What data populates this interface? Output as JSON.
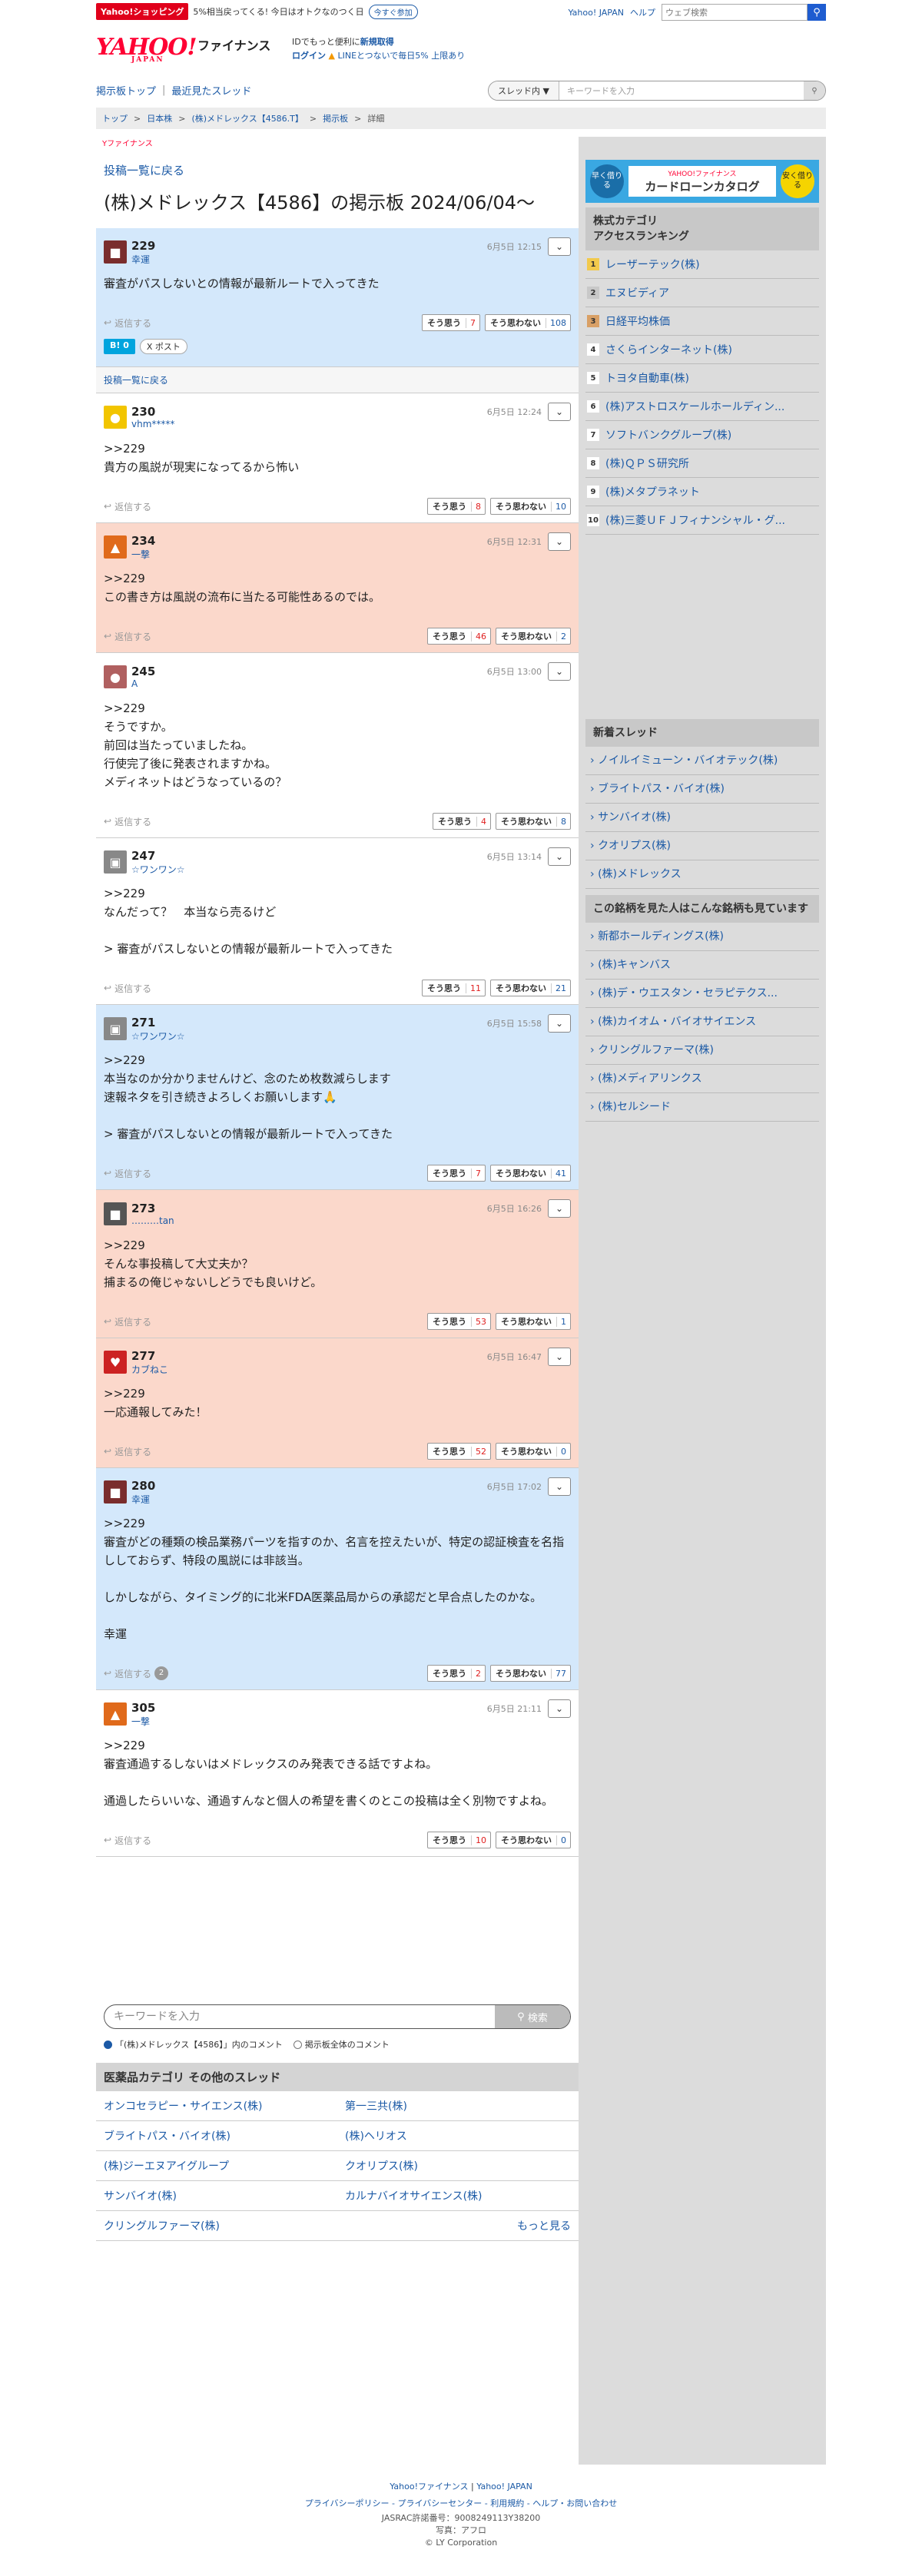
{
  "promo": {
    "badge": "Yahoo!ショッピング",
    "text": "5%相当戻ってくる! 今日はオトクなのつく日",
    "join": "今すぐ参加"
  },
  "toplinks": {
    "yahoo": "Yahoo! JAPAN",
    "help": "ヘルプ",
    "search_placeholder": "ウェブ検索"
  },
  "header": {
    "logo": "YAHOO!",
    "logo_sub": "JAPAN",
    "service": "ファイナンス",
    "line1_pre": "IDでもっと便利に",
    "line1_link": "新規取得",
    "line2_login": "ログイン",
    "line2_text": "LINEとつないで毎日5%",
    "line2_link": "上限あり"
  },
  "nav": {
    "boards_top": "掲示板トップ",
    "recent": "最近見たスレッド",
    "scope": "スレッド内",
    "placeholder": "キーワードを入力"
  },
  "breadcrumb": [
    "トップ",
    "日本株",
    "(株)メドレックス【4586.T】",
    "掲示板",
    "詳細"
  ],
  "page": {
    "brand": "Yファイナンス",
    "back_top": "投稿一覧に戻る",
    "title": "(株)メドレックス【4586】の掲示板 2024/06/04〜",
    "back_bar": "投稿一覧に戻る"
  },
  "labels": {
    "reply": "返信する",
    "agree": "そう思う",
    "disagree": "そう思わない",
    "hatena": "B! 0",
    "x": "X ポスト"
  },
  "posts": [
    {
      "num": "229",
      "user": "幸運",
      "date": "6月5日 12:15",
      "body": "審査がパスしないとの情報が最新ルートで入ってきた",
      "agree": "7",
      "disagree": "108",
      "color": "blue"
    },
    {
      "num": "230",
      "user": "vhm*****",
      "date": "6月5日 12:24",
      "body": ">>229\n貴方の風説が現実になってるから怖い",
      "agree": "8",
      "disagree": "10",
      "color": "white"
    },
    {
      "num": "234",
      "user": "一撃",
      "date": "6月5日 12:31",
      "body": ">>229\nこの書き方は風説の流布に当たる可能性あるのでは。",
      "agree": "46",
      "disagree": "2",
      "color": "pink"
    },
    {
      "num": "245",
      "user": "A",
      "date": "6月5日 13:00",
      "body": ">>229\nそうですか。\n前回は当たっていましたね。\n行使完了後に発表されますかね。\nメディネットはどうなっているの？",
      "agree": "4",
      "disagree": "8",
      "color": "white"
    },
    {
      "num": "247",
      "user": "☆ワンワン☆",
      "date": "6月5日 13:14",
      "body": ">>229\nなんだって？　本当なら売るけど\n\n> 審査がパスしないとの情報が最新ルートで入ってきた",
      "agree": "11",
      "disagree": "21",
      "color": "white"
    },
    {
      "num": "271",
      "user": "☆ワンワン☆",
      "date": "6月5日 15:58",
      "body": ">>229\n本当なのか分かりませんけど、念のため枚数減らします\n速報ネタを引き続きよろしくお願いします🙏\n\n> 審査がパスしないとの情報が最新ルートで入ってきた",
      "agree": "7",
      "disagree": "41",
      "color": "blue"
    },
    {
      "num": "273",
      "user": "………tan",
      "date": "6月5日 16:26",
      "body": ">>229\nそんな事投稿して大丈夫か？\n捕まるの俺じゃないしどうでも良いけど。",
      "agree": "53",
      "disagree": "1",
      "color": "pink"
    },
    {
      "num": "277",
      "user": "カブねこ",
      "date": "6月5日 16:47",
      "body": ">>229\n一応通報してみた！",
      "agree": "52",
      "disagree": "0",
      "color": "pink"
    },
    {
      "num": "280",
      "user": "幸運",
      "date": "6月5日 17:02",
      "body": ">>229\n審査がどの種類の検品業務パーツを指すのか、名言を控えたいが、特定の認証検査を名指ししておらず、特段の風説には非該当。\n\nしかしながら、タイミング的に北米FDA医薬品局からの承認だと早合点したのかな。\n\n幸運",
      "agree": "2",
      "disagree": "77",
      "color": "blue",
      "replies": "2"
    },
    {
      "num": "305",
      "user": "一撃",
      "date": "6月5日 21:11",
      "body": ">>229\n審査通過するしないはメドレックスのみ発表できる話ですよね。\n\n通過したらいいな、通過すんなと個人の希望を書くのとこの投稿は全く別物ですよね。",
      "agree": "10",
      "disagree": "0",
      "color": "white"
    }
  ],
  "bottom_search": {
    "placeholder": "キーワードを入力",
    "button": "検索",
    "opt1": "「(株)メドレックス【4586】」内のコメント",
    "opt2": "掲示板全体のコメント"
  },
  "other": {
    "title": "医薬品カテゴリ その他のスレッド",
    "items": [
      "オンコセラピー・サイエンス(株)",
      "第一三共(株)",
      "ブライトパス・バイオ(株)",
      "(株)ヘリオス",
      "(株)ジーエヌアイグループ",
      "クオリプス(株)",
      "サンバイオ(株)",
      "カルナバイオサイエンス(株)",
      "クリングルファーマ(株)"
    ],
    "more": "もっと見る"
  },
  "ad": {
    "left": "早く借りる",
    "center": "カードローンカタログ",
    "brand": "YAHOO!ファイナンス",
    "right": "安く借りる"
  },
  "ranking": {
    "title": "株式カテゴリ\nアクセスランキング",
    "items": [
      "レーザーテック(株)",
      "エヌビディア",
      "日経平均株価",
      "さくらインターネット(株)",
      "トヨタ自動車(株)",
      "(株)アストロスケールホールディン...",
      "ソフトバンクグループ(株)",
      "(株)ＱＰＳ研究所",
      "(株)メタプラネット",
      "(株)三菱ＵＦＪフィナンシャル・グ..."
    ]
  },
  "new_threads": {
    "title": "新着スレッド",
    "items": [
      "ノイルイミューン・バイオテック(株)",
      "ブライトパス・バイオ(株)",
      "サンバイオ(株)",
      "クオリプス(株)",
      "(株)メドレックス"
    ]
  },
  "also_viewed": {
    "title": "この銘柄を見た人はこんな銘柄も見ています",
    "items": [
      "新都ホールディングス(株)",
      "(株)キャンバス",
      "(株)デ・ウエスタン・セラピテクス...",
      "(株)カイオム・バイオサイエンス",
      "クリングルファーマ(株)",
      "(株)メディアリンクス",
      "(株)セルシード"
    ]
  },
  "footer": {
    "l1a": "Yahoo!ファイナンス",
    "l1b": "Yahoo! JAPAN",
    "l2": "プライバシーポリシー - プライバシーセンター - 利用規約 - ヘルプ・お問い合わせ",
    "jasrac": "JASRAC許諾番号：9008249113Y38200",
    "photo": "写真：アフロ",
    "copy": "© LY Corporation"
  }
}
